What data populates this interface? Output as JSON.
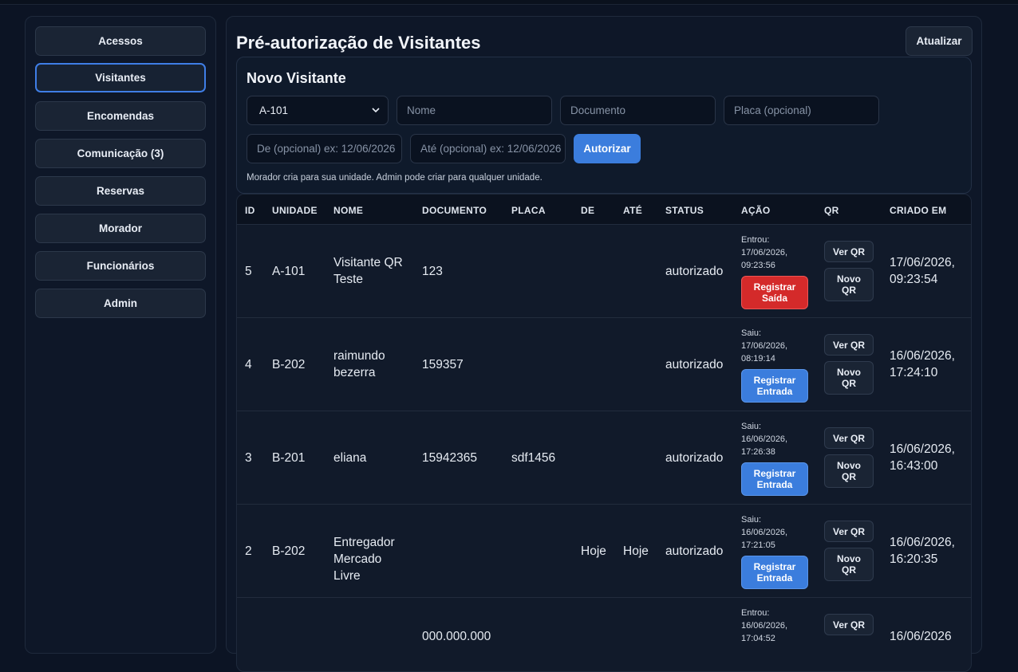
{
  "sidebar": {
    "items": [
      {
        "label": "Acessos"
      },
      {
        "label": "Visitantes"
      },
      {
        "label": "Encomendas"
      },
      {
        "label": "Comunicação (3)"
      },
      {
        "label": "Reservas"
      },
      {
        "label": "Morador"
      },
      {
        "label": "Funcionários"
      },
      {
        "label": "Admin"
      }
    ],
    "active": "Visitantes"
  },
  "main": {
    "title": "Pré-autorização de Visitantes",
    "refresh_label": "Atualizar"
  },
  "form": {
    "title": "Novo Visitante",
    "unit_selected": "A-101",
    "name_placeholder": "Nome",
    "document_placeholder": "Documento",
    "plate_placeholder": "Placa (opcional)",
    "from_placeholder": "De (opcional) ex: 12/06/2026",
    "to_placeholder": "Até (opcional) ex: 12/06/2026",
    "submit_label": "Autorizar",
    "hint": "Morador cria para sua unidade. Admin pode criar para qualquer unidade."
  },
  "table": {
    "headers": {
      "id": "ID",
      "unit": "UNIDADE",
      "name": "NOME",
      "document": "DOCUMENTO",
      "plate": "PLACA",
      "from": "DE",
      "to": "ATÉ",
      "status": "STATUS",
      "action": "AÇÃO",
      "qr": "QR",
      "created": "CRIADO EM"
    },
    "view_qr_label": "Ver QR",
    "new_qr_label": "Novo QR",
    "rows": [
      {
        "id": "5",
        "unit": "A-101",
        "name": "Visitante QR Teste",
        "document": "123",
        "plate": "",
        "from": "",
        "to": "",
        "status": "autorizado",
        "event_label": "Entrou:",
        "event_time": "17/06/2026, 09:23:56",
        "action_label": "Registrar Saída",
        "action_type": "out",
        "created": "17/06/2026, 09:23:54"
      },
      {
        "id": "4",
        "unit": "B-202",
        "name": "raimundo bezerra",
        "document": "159357",
        "plate": "",
        "from": "",
        "to": "",
        "status": "autorizado",
        "event_label": "Saiu:",
        "event_time": "17/06/2026, 08:19:14",
        "action_label": "Registrar Entrada",
        "action_type": "in",
        "created": "16/06/2026, 17:24:10"
      },
      {
        "id": "3",
        "unit": "B-201",
        "name": "eliana",
        "document": "15942365",
        "plate": "sdf1456",
        "from": "",
        "to": "",
        "status": "autorizado",
        "event_label": "Saiu:",
        "event_time": "16/06/2026, 17:26:38",
        "action_label": "Registrar Entrada",
        "action_type": "in",
        "created": "16/06/2026, 16:43:00"
      },
      {
        "id": "2",
        "unit": "B-202",
        "name": "Entregador Mercado Livre",
        "document": "",
        "plate": "",
        "from": "Hoje",
        "to": "Hoje",
        "status": "autorizado",
        "event_label": "Saiu:",
        "event_time": "16/06/2026, 17:21:05",
        "action_label": "Registrar Entrada",
        "action_type": "in",
        "created": "16/06/2026, 16:20:35"
      },
      {
        "id": "",
        "unit": "",
        "name": "",
        "document": "000.000.000",
        "plate": "",
        "from": "",
        "to": "",
        "status": "",
        "event_label": "Entrou:",
        "event_time": "16/06/2026, 17:04:52",
        "action_label": "",
        "action_type": "in",
        "created": "16/06/2026"
      }
    ]
  }
}
